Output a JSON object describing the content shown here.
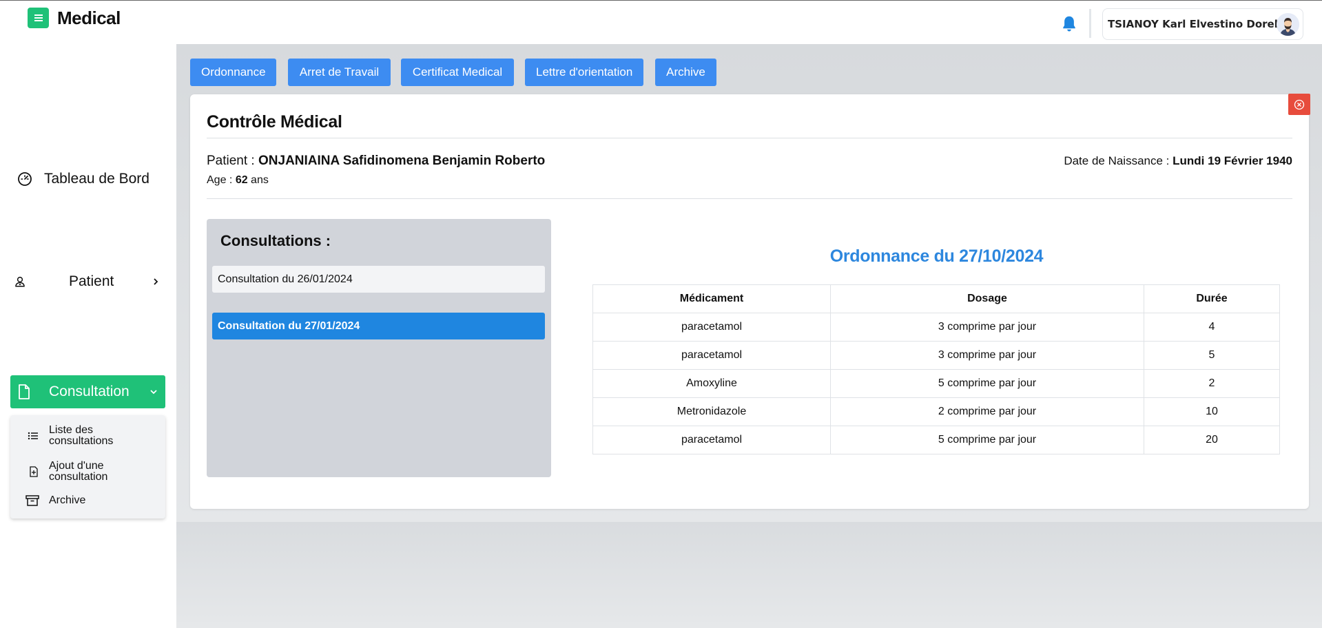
{
  "app": {
    "title": "Medical"
  },
  "header": {
    "user_name": "TSIANOY Karl Elvestino Dorelin"
  },
  "sidebar": {
    "items": [
      {
        "label": "Tableau de Bord"
      },
      {
        "label": "Patient"
      },
      {
        "label": "Consultation"
      }
    ],
    "submenu": [
      {
        "label": "Liste des consultations"
      },
      {
        "label": "Ajout d'une consultation"
      },
      {
        "label": "Archive"
      }
    ]
  },
  "tabs": [
    {
      "label": "Ordonnance"
    },
    {
      "label": "Arret de Travail"
    },
    {
      "label": "Certificat Medical"
    },
    {
      "label": "Lettre d'orientation"
    },
    {
      "label": "Archive"
    }
  ],
  "card": {
    "title": "Contrôle Médical",
    "patient_prefix": "Patient : ",
    "patient_name": "ONJANIAINA Safidinomena Benjamin Roberto",
    "age_prefix": "Age : ",
    "age_value": "62",
    "age_suffix": " ans",
    "dob_prefix": "Date de Naissance : ",
    "dob_value": "Lundi 19 Février 1940"
  },
  "consultations": {
    "title": "Consultations :",
    "items": [
      {
        "label": "Consultation du 26/01/2024",
        "selected": false
      },
      {
        "label": "Consultation du 27/01/2024",
        "selected": true
      }
    ]
  },
  "ordonnance": {
    "title": "Ordonnance du 27/10/2024",
    "columns": [
      "Médicament",
      "Dosage",
      "Durée"
    ],
    "rows": [
      [
        "paracetamol",
        "3 comprime par jour",
        "4"
      ],
      [
        "paracetamol",
        "3 comprime par jour",
        "5"
      ],
      [
        "Amoxyline",
        "5 comprime par jour",
        "2"
      ],
      [
        "Metronidazole",
        "2 comprime par jour",
        "10"
      ],
      [
        "paracetamol",
        "5 comprime par jour",
        "20"
      ]
    ]
  },
  "colors": {
    "brand_green": "#1fc178",
    "tab_blue": "#3d8cf1",
    "selected_blue": "#1f86e0",
    "close_red": "#e74c3c",
    "title_blue": "#2d87de"
  }
}
